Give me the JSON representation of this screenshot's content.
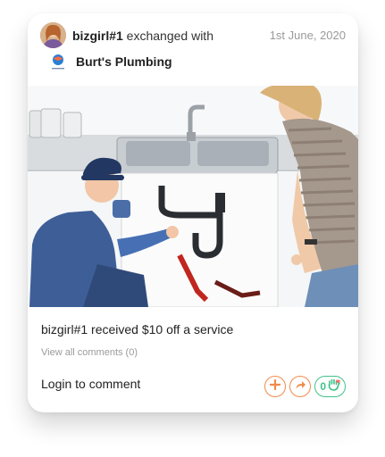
{
  "post": {
    "username": "bizgirl#1",
    "action_text": " exchanged with",
    "date": "1st June, 2020",
    "business_name": "Burt's Plumbing",
    "summary": "bizgirl#1 received $10 off a service",
    "view_comments": "View all comments (0)",
    "login_comment": "Login to comment",
    "likes_count": "0"
  },
  "colors": {
    "accent_orange": "#f08a4b",
    "accent_green": "#3fc28a"
  },
  "icons": {
    "add": "plus-icon",
    "share": "share-arrow-icon",
    "like": "heart-hand-icon"
  }
}
